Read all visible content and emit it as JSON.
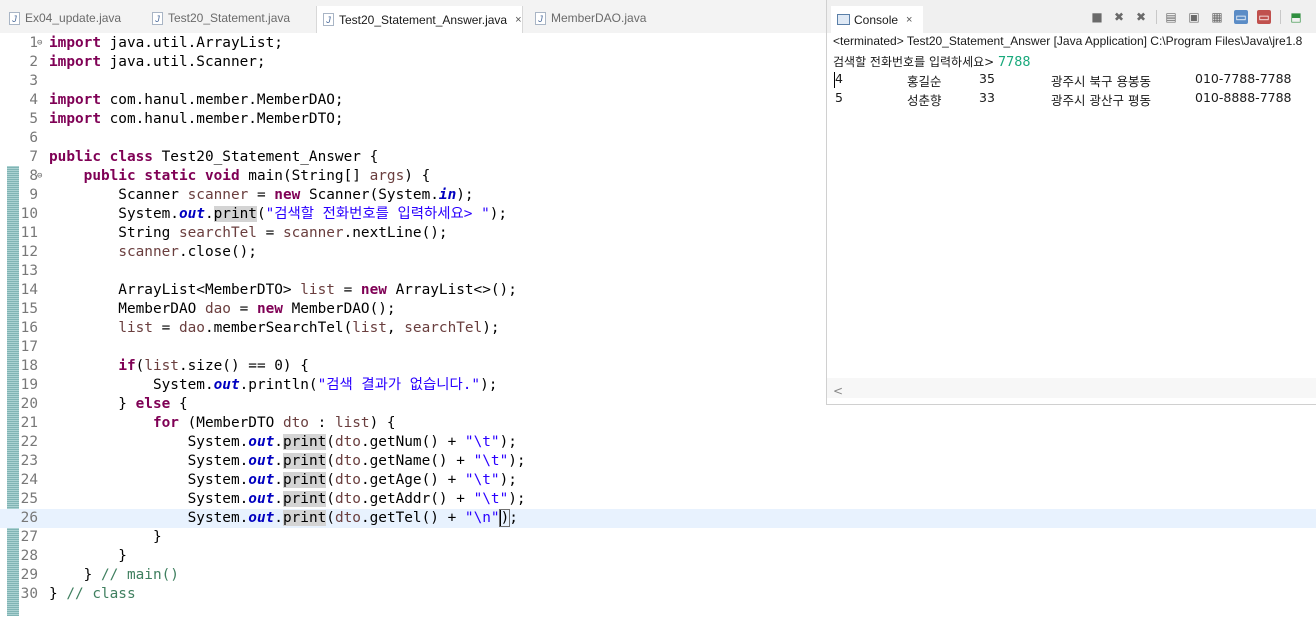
{
  "editor_tabs": [
    {
      "label": "Ex04_update.java",
      "active": false
    },
    {
      "label": "Test20_Statement.java",
      "active": false
    },
    {
      "label": "Test20_Statement_Answer.java",
      "active": true
    },
    {
      "label": "MemberDAO.java",
      "active": false
    }
  ],
  "tab_close_glyph": "×",
  "editor": {
    "line_numbers": [
      "1",
      "2",
      "3",
      "4",
      "5",
      "6",
      "7",
      "8",
      "9",
      "10",
      "11",
      "12",
      "13",
      "14",
      "15",
      "16",
      "17",
      "18",
      "19",
      "20",
      "21",
      "22",
      "23",
      "24",
      "25",
      "26",
      "27",
      "28",
      "29",
      "30"
    ],
    "current_line": 26
  },
  "console": {
    "tab_label": "Console",
    "terminated_text": "<terminated> Test20_Statement_Answer [Java Application] C:\\Program Files\\Java\\jre1.8",
    "prompt": "검색할 전화번호를 입력하세요> ",
    "input_value": "7788",
    "rows": [
      {
        "num": "4",
        "name": "홍길순",
        "age": "35",
        "addr": "광주시 북구 용봉동",
        "tel": "010-7788-7788"
      },
      {
        "num": "5",
        "name": "성춘향",
        "age": "33",
        "addr": "광주시 광산구 평동",
        "tel": "010-8888-7788"
      }
    ],
    "scroll_left_glyph": "<",
    "toolbar": [
      "terminate-icon",
      "remove-launch-icon",
      "remove-all-icon",
      "scroll-lock-icon",
      "word-wrap-icon",
      "show-on-output-icon",
      "pin-console-icon",
      "display-console-icon",
      "open-console-icon",
      "minimize-icon"
    ]
  }
}
